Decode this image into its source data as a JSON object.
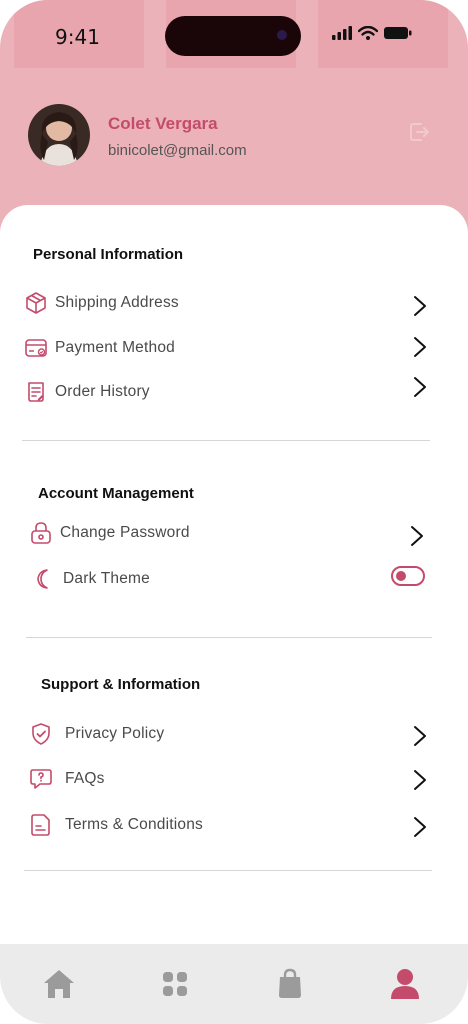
{
  "status_bar": {
    "time": "9:41"
  },
  "profile": {
    "name": "Colet Vergara",
    "email": "binicolet@gmail.com"
  },
  "sections": [
    {
      "title": "Personal Information",
      "items": [
        {
          "label": "Shipping Address",
          "icon": "package-icon"
        },
        {
          "label": "Payment Method",
          "icon": "credit-card-icon"
        },
        {
          "label": "Order History",
          "icon": "receipt-icon"
        }
      ]
    },
    {
      "title": "Account Management",
      "items": [
        {
          "label": "Change Password",
          "icon": "lock-icon"
        },
        {
          "label": "Dark Theme",
          "icon": "moon-icon",
          "toggle": false
        }
      ]
    },
    {
      "title": "Support & Information",
      "items": [
        {
          "label": "Privacy Policy",
          "icon": "shield-check-icon"
        },
        {
          "label": "FAQs",
          "icon": "question-icon"
        },
        {
          "label": "Terms & Conditions",
          "icon": "document-icon"
        }
      ]
    }
  ],
  "tab_bar": {
    "items": [
      {
        "icon": "home-icon",
        "active": false
      },
      {
        "icon": "categories-icon",
        "active": false
      },
      {
        "icon": "shopping-bag-icon",
        "active": false
      },
      {
        "icon": "profile-icon",
        "active": true
      }
    ]
  },
  "colors": {
    "accent": "#c44b6b",
    "header_bg": "#ebb3b9",
    "inactive_icon": "#9b9b9b"
  }
}
